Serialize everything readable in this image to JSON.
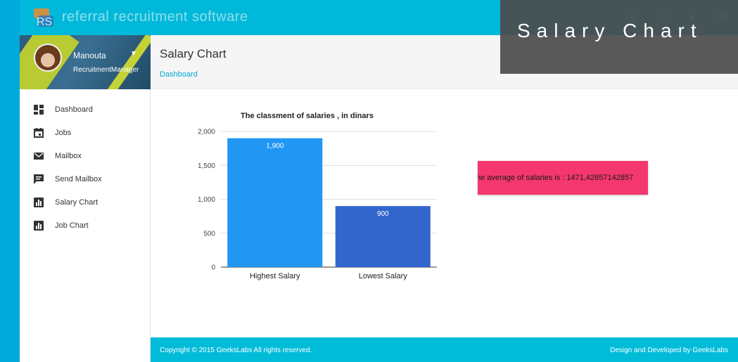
{
  "app": {
    "brand": "referral recruitment software"
  },
  "overlay": {
    "title": "Salary Chart"
  },
  "sidebar": {
    "user": {
      "name": "Manouta",
      "role": "RecruitmentManager"
    },
    "items": [
      {
        "label": "Dashboard",
        "icon": "dashboard-icon"
      },
      {
        "label": "Jobs",
        "icon": "calendar-icon"
      },
      {
        "label": "Mailbox",
        "icon": "mail-icon"
      },
      {
        "label": "Send Mailbox",
        "icon": "chat-icon"
      },
      {
        "label": "Salary Chart",
        "icon": "bar-chart-icon"
      },
      {
        "label": "Job Chart",
        "icon": "bar-chart-icon"
      }
    ]
  },
  "header": {
    "title": "Salary Chart",
    "breadcrumb": "Dashboard"
  },
  "average": {
    "text": "he average of salaries is : 1471,42857142857"
  },
  "footer": {
    "copyright": "Copyright © 2015 GeeksLabs All rights reserved.",
    "credit": "Design and Developed by GeeksLabs"
  },
  "colors": {
    "accent": "#00b9da",
    "bar1": "#2196f3",
    "bar2": "#3366cc",
    "avg_box": "#f4376f"
  },
  "chart_data": {
    "type": "bar",
    "title": "The classment of salaries , in dinars",
    "categories": [
      "Highest Salary",
      "Lowest Salary"
    ],
    "values": [
      1900,
      900
    ],
    "data_labels": [
      "1,900",
      "900"
    ],
    "yticks": [
      "0",
      "500",
      "1,000",
      "1,500",
      "2,000"
    ],
    "ytick_values": [
      0,
      500,
      1000,
      1500,
      2000
    ],
    "ylim": [
      0,
      2000
    ],
    "grid": true,
    "xlabel": "",
    "ylabel": ""
  }
}
